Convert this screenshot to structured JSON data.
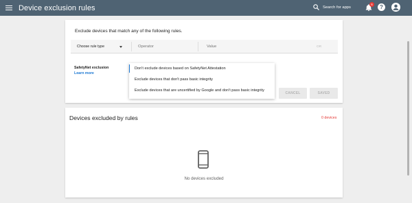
{
  "appbar": {
    "title": "Device exclusion rules",
    "search_label": "Search for apps",
    "notification_count": "6",
    "help_label": "?",
    "bg_color": "#4f6373"
  },
  "rules_card": {
    "heading": "Exclude devices that match any of the following rules.",
    "rule_type_label": "Choose rule type",
    "operator_placeholder": "Operator",
    "value_placeholder": "Value",
    "or_label": "OR",
    "safetynet_label": "SafetyNet exclusion",
    "learn_more": "Learn more",
    "dropdown_options": [
      "Don't exclude devices based on SafetyNet Attestation",
      "Exclude devices that don't pass basic integrity",
      "Exclude devices that are uncertified by Google and don't pass basic integrity"
    ],
    "cancel_label": "CANCEL",
    "saved_label": "SAVED"
  },
  "excluded_card": {
    "title": "Devices excluded by rules",
    "count": "0 devices",
    "empty_text": "No devices excluded",
    "empty_icon": "smartphone-icon"
  },
  "colors": {
    "accent": "#1976d2",
    "count_red": "#e53935"
  }
}
